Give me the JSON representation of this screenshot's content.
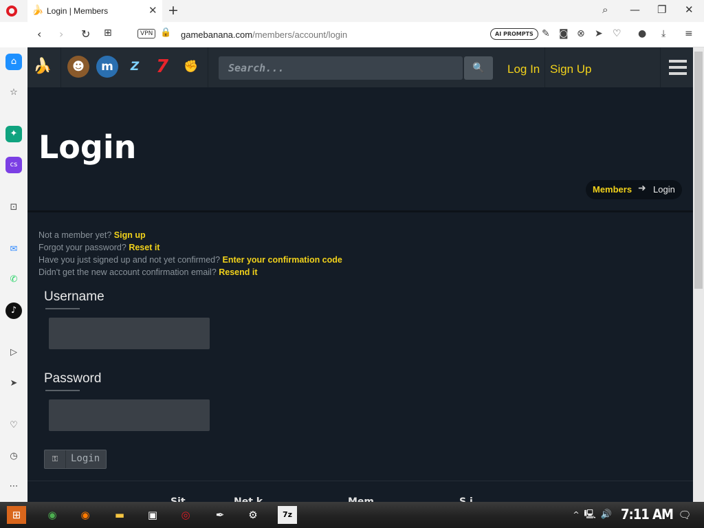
{
  "browser": {
    "tab_title": "Login | Members",
    "url_host": "gamebanana.com",
    "url_path": "/members/account/login",
    "vpn_label": "VPN",
    "ai_prompts_label": "AI PROMPTS",
    "tab_close_glyph": "✕",
    "new_tab_glyph": "+"
  },
  "site": {
    "search_placeholder": "Search...",
    "login_link": "Log In",
    "signup_link": "Sign Up",
    "page_title": "Login",
    "breadcrumb": {
      "parent": "Members",
      "current": "Login"
    },
    "info": [
      {
        "text": "Not a member yet? ",
        "link": "Sign up"
      },
      {
        "text": "Forgot your password? ",
        "link": "Reset it"
      },
      {
        "text": "Have you just signed up and not yet confirmed? ",
        "link": "Enter your confirmation code"
      },
      {
        "text": "Didn't get the new account confirmation email? ",
        "link": "Resend it"
      }
    ],
    "form": {
      "username_label": "Username",
      "password_label": "Password",
      "username_value": "",
      "password_value": "",
      "login_button": "Login"
    },
    "footer_peek": [
      "Sit",
      "Net k",
      "Mem",
      "S i "
    ]
  },
  "taskbar": {
    "clock": "7:11 AM"
  },
  "colors": {
    "accent": "#f2d21b",
    "page_bg": "#141c26",
    "nav_bg": "#232b33"
  }
}
